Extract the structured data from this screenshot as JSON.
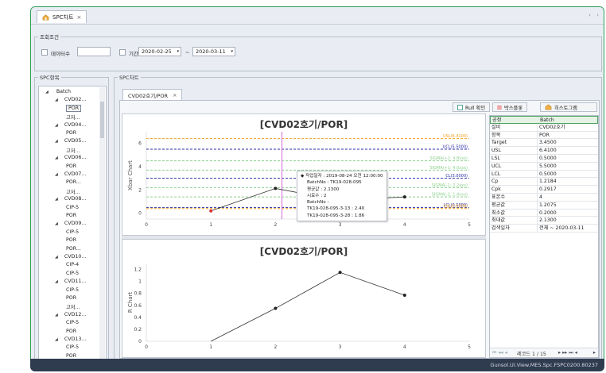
{
  "doc_tab": {
    "label": "SPC차트",
    "close": "×"
  },
  "nav": {
    "left": "‹",
    "right": "›"
  },
  "query": {
    "title": "조회조건",
    "data_count_label": "데이터수",
    "data_count_value": "",
    "period_label": "기간",
    "date_from": "2020-02-25",
    "date_sep": "~",
    "date_to": "2020-03-11"
  },
  "spc_items": {
    "title": "SPC항목",
    "tree": [
      {
        "label": "Batch",
        "depth": 0,
        "expanded": true
      },
      {
        "label": "CVD02...",
        "depth": 1,
        "expanded": true
      },
      {
        "label": "POR",
        "depth": 2,
        "selected": true
      },
      {
        "label": "고저...",
        "depth": 2
      },
      {
        "label": "CVD04...",
        "depth": 1,
        "expanded": true
      },
      {
        "label": "POR",
        "depth": 2
      },
      {
        "label": "CVD05...",
        "depth": 1,
        "expanded": true
      },
      {
        "label": "고저...",
        "depth": 2
      },
      {
        "label": "CVD06...",
        "depth": 1,
        "expanded": true
      },
      {
        "label": "POR",
        "depth": 2
      },
      {
        "label": "CVD07...",
        "depth": 1,
        "expanded": true
      },
      {
        "label": "POR...",
        "depth": 2
      },
      {
        "label": "고저...",
        "depth": 2
      },
      {
        "label": "CVD08...",
        "depth": 1,
        "expanded": true
      },
      {
        "label": "CIP-5",
        "depth": 2
      },
      {
        "label": "POR",
        "depth": 2
      },
      {
        "label": "CVD09...",
        "depth": 1,
        "expanded": true
      },
      {
        "label": "CIP-5",
        "depth": 2
      },
      {
        "label": "POR",
        "depth": 2
      },
      {
        "label": "POR...",
        "depth": 2
      },
      {
        "label": "CVD10...",
        "depth": 1,
        "expanded": true
      },
      {
        "label": "CIP-4",
        "depth": 2
      },
      {
        "label": "CIP-5",
        "depth": 2
      },
      {
        "label": "CVD11...",
        "depth": 1,
        "expanded": true
      },
      {
        "label": "CIP-5",
        "depth": 2
      },
      {
        "label": "POR",
        "depth": 2
      },
      {
        "label": "고저...",
        "depth": 2
      },
      {
        "label": "CVD12...",
        "depth": 1,
        "expanded": true
      },
      {
        "label": "CIP-5",
        "depth": 2
      },
      {
        "label": "POR",
        "depth": 2
      },
      {
        "label": "CVD13...",
        "depth": 1,
        "expanded": true
      },
      {
        "label": "CIP-5",
        "depth": 2
      },
      {
        "label": "POR",
        "depth": 2
      }
    ]
  },
  "spc_chart": {
    "title": "SPC차트",
    "tab_label": "CVD02호기/POR",
    "tab_close": "×",
    "rull_label": "Rull 확인",
    "boxplot_label": "박스플롯",
    "histogram_label": "히스토그램"
  },
  "chart_data": [
    {
      "type": "line",
      "title": "[CVD02호기/POR]",
      "ylabel": "Xbar Chart",
      "xlabel": "",
      "x": [
        1,
        2,
        3,
        4
      ],
      "values": [
        0.2,
        2.13,
        1.1,
        1.4
      ],
      "xlim": [
        0,
        5
      ],
      "ylim": [
        -0.5,
        7
      ],
      "xticks": [
        "0",
        "1",
        "2",
        "3",
        "4",
        "5"
      ],
      "yticks": [
        "0",
        "2",
        "4",
        "6"
      ],
      "grid": true,
      "limit_lines": [
        {
          "label": "USL(6.4100)",
          "value": 6.41,
          "color": "#f0a020"
        },
        {
          "label": "UCL(5.5000)",
          "value": 5.5,
          "color": "#2c2fa8"
        },
        {
          "label": "SIGMA(+2: 4.8xxx)",
          "value": 4.5,
          "color": "#8fd08f"
        },
        {
          "label": "SIGMA(+1: 4.0xxx)",
          "value": 3.7,
          "color": "#8fd08f"
        },
        {
          "label": "CL(3.0000)",
          "value": 3.0,
          "color": "#2c2fa8"
        },
        {
          "label": "SIGMA(-1: 2.2xxx)",
          "value": 2.2,
          "color": "#8fd08f"
        },
        {
          "label": "SIGMA(-2: 1.4xxx)",
          "value": 1.4,
          "color": "#8fd08f"
        },
        {
          "label": "LCL(0.5000)",
          "value": 0.5,
          "color": "#2c2fa8"
        },
        {
          "label": "LSL(0.5000)",
          "value": 0.4,
          "color": "#f0a020"
        }
      ],
      "highlight_x": 2.1,
      "highlight_color": "#d36ad3"
    },
    {
      "type": "line",
      "title": "[CVD02호기/POR]",
      "ylabel": "R Chart",
      "xlabel": "",
      "x": [
        2,
        3,
        4
      ],
      "values": [
        0.55,
        1.15,
        0.77
      ],
      "x_start": [
        1,
        0
      ],
      "xlim": [
        0,
        5
      ],
      "ylim": [
        0,
        1.3
      ],
      "xticks": [
        "0",
        "1",
        "2",
        "3",
        "4",
        "5"
      ],
      "yticks": [
        "0",
        "0.2",
        "0.4",
        "0.6",
        "0.8",
        "1",
        "1.2"
      ],
      "grid": false
    }
  ],
  "tooltip": {
    "lines": [
      "작업일자 : 2019-08-24 오전 12:00:00",
      "BatchNo : TK19-028-095",
      "평균값 : 2.1300",
      "시료수 : 2",
      "BatchNo :",
      "TK19-028-095-3-13 : 2.40",
      "TK19-028-095-3-28 : 1.86"
    ]
  },
  "info_grid": {
    "rows": [
      {
        "key": "공정",
        "value": "Batch",
        "highlight": true
      },
      {
        "key": "설비",
        "value": "CVD02호기"
      },
      {
        "key": "항목",
        "value": "POR"
      },
      {
        "key": "Target",
        "value": "3.4500"
      },
      {
        "key": "USL",
        "value": "6.4100"
      },
      {
        "key": "LSL",
        "value": "0.5000"
      },
      {
        "key": "UCL",
        "value": "5.5000"
      },
      {
        "key": "LCL",
        "value": "0.5000"
      },
      {
        "key": "Cp",
        "value": "1.2184"
      },
      {
        "key": "Cpk",
        "value": "0.2917"
      },
      {
        "key": "표본수",
        "value": "4"
      },
      {
        "key": "평균값",
        "value": "1.2075"
      },
      {
        "key": "최소값",
        "value": "0.2000"
      },
      {
        "key": "최대값",
        "value": "2.1300"
      },
      {
        "key": "검색일자",
        "value": "전체 ~ 2020-03-11"
      }
    ],
    "pager_text": "레코드 1 / 15"
  },
  "status_bar": {
    "text": "Gunsol.UI.View.MES.Spc.FSPC0200.80237"
  }
}
